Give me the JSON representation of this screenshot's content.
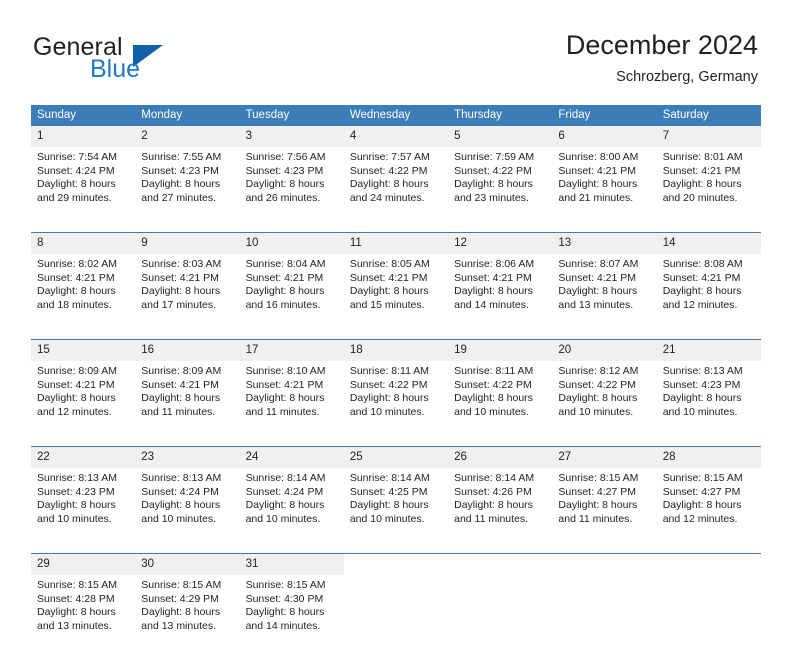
{
  "brand": {
    "name_part1": "General",
    "name_part2": "Blue",
    "triangle_color": "#1260a8",
    "blue_color": "#2079c7"
  },
  "header": {
    "title": "December 2024",
    "location": "Schrozberg, Germany"
  },
  "theme": {
    "header_blue": "#3b7cb9",
    "daynum_bg": "#f0f0f0",
    "text": "#231f20"
  },
  "weekday_headers": [
    "Sunday",
    "Monday",
    "Tuesday",
    "Wednesday",
    "Thursday",
    "Friday",
    "Saturday"
  ],
  "weeks": [
    [
      {
        "day": "1",
        "sunrise": "Sunrise: 7:54 AM",
        "sunset": "Sunset: 4:24 PM",
        "daylight1": "Daylight: 8 hours",
        "daylight2": "and 29 minutes."
      },
      {
        "day": "2",
        "sunrise": "Sunrise: 7:55 AM",
        "sunset": "Sunset: 4:23 PM",
        "daylight1": "Daylight: 8 hours",
        "daylight2": "and 27 minutes."
      },
      {
        "day": "3",
        "sunrise": "Sunrise: 7:56 AM",
        "sunset": "Sunset: 4:23 PM",
        "daylight1": "Daylight: 8 hours",
        "daylight2": "and 26 minutes."
      },
      {
        "day": "4",
        "sunrise": "Sunrise: 7:57 AM",
        "sunset": "Sunset: 4:22 PM",
        "daylight1": "Daylight: 8 hours",
        "daylight2": "and 24 minutes."
      },
      {
        "day": "5",
        "sunrise": "Sunrise: 7:59 AM",
        "sunset": "Sunset: 4:22 PM",
        "daylight1": "Daylight: 8 hours",
        "daylight2": "and 23 minutes."
      },
      {
        "day": "6",
        "sunrise": "Sunrise: 8:00 AM",
        "sunset": "Sunset: 4:21 PM",
        "daylight1": "Daylight: 8 hours",
        "daylight2": "and 21 minutes."
      },
      {
        "day": "7",
        "sunrise": "Sunrise: 8:01 AM",
        "sunset": "Sunset: 4:21 PM",
        "daylight1": "Daylight: 8 hours",
        "daylight2": "and 20 minutes."
      }
    ],
    [
      {
        "day": "8",
        "sunrise": "Sunrise: 8:02 AM",
        "sunset": "Sunset: 4:21 PM",
        "daylight1": "Daylight: 8 hours",
        "daylight2": "and 18 minutes."
      },
      {
        "day": "9",
        "sunrise": "Sunrise: 8:03 AM",
        "sunset": "Sunset: 4:21 PM",
        "daylight1": "Daylight: 8 hours",
        "daylight2": "and 17 minutes."
      },
      {
        "day": "10",
        "sunrise": "Sunrise: 8:04 AM",
        "sunset": "Sunset: 4:21 PM",
        "daylight1": "Daylight: 8 hours",
        "daylight2": "and 16 minutes."
      },
      {
        "day": "11",
        "sunrise": "Sunrise: 8:05 AM",
        "sunset": "Sunset: 4:21 PM",
        "daylight1": "Daylight: 8 hours",
        "daylight2": "and 15 minutes."
      },
      {
        "day": "12",
        "sunrise": "Sunrise: 8:06 AM",
        "sunset": "Sunset: 4:21 PM",
        "daylight1": "Daylight: 8 hours",
        "daylight2": "and 14 minutes."
      },
      {
        "day": "13",
        "sunrise": "Sunrise: 8:07 AM",
        "sunset": "Sunset: 4:21 PM",
        "daylight1": "Daylight: 8 hours",
        "daylight2": "and 13 minutes."
      },
      {
        "day": "14",
        "sunrise": "Sunrise: 8:08 AM",
        "sunset": "Sunset: 4:21 PM",
        "daylight1": "Daylight: 8 hours",
        "daylight2": "and 12 minutes."
      }
    ],
    [
      {
        "day": "15",
        "sunrise": "Sunrise: 8:09 AM",
        "sunset": "Sunset: 4:21 PM",
        "daylight1": "Daylight: 8 hours",
        "daylight2": "and 12 minutes."
      },
      {
        "day": "16",
        "sunrise": "Sunrise: 8:09 AM",
        "sunset": "Sunset: 4:21 PM",
        "daylight1": "Daylight: 8 hours",
        "daylight2": "and 11 minutes."
      },
      {
        "day": "17",
        "sunrise": "Sunrise: 8:10 AM",
        "sunset": "Sunset: 4:21 PM",
        "daylight1": "Daylight: 8 hours",
        "daylight2": "and 11 minutes."
      },
      {
        "day": "18",
        "sunrise": "Sunrise: 8:11 AM",
        "sunset": "Sunset: 4:22 PM",
        "daylight1": "Daylight: 8 hours",
        "daylight2": "and 10 minutes."
      },
      {
        "day": "19",
        "sunrise": "Sunrise: 8:11 AM",
        "sunset": "Sunset: 4:22 PM",
        "daylight1": "Daylight: 8 hours",
        "daylight2": "and 10 minutes."
      },
      {
        "day": "20",
        "sunrise": "Sunrise: 8:12 AM",
        "sunset": "Sunset: 4:22 PM",
        "daylight1": "Daylight: 8 hours",
        "daylight2": "and 10 minutes."
      },
      {
        "day": "21",
        "sunrise": "Sunrise: 8:13 AM",
        "sunset": "Sunset: 4:23 PM",
        "daylight1": "Daylight: 8 hours",
        "daylight2": "and 10 minutes."
      }
    ],
    [
      {
        "day": "22",
        "sunrise": "Sunrise: 8:13 AM",
        "sunset": "Sunset: 4:23 PM",
        "daylight1": "Daylight: 8 hours",
        "daylight2": "and 10 minutes."
      },
      {
        "day": "23",
        "sunrise": "Sunrise: 8:13 AM",
        "sunset": "Sunset: 4:24 PM",
        "daylight1": "Daylight: 8 hours",
        "daylight2": "and 10 minutes."
      },
      {
        "day": "24",
        "sunrise": "Sunrise: 8:14 AM",
        "sunset": "Sunset: 4:24 PM",
        "daylight1": "Daylight: 8 hours",
        "daylight2": "and 10 minutes."
      },
      {
        "day": "25",
        "sunrise": "Sunrise: 8:14 AM",
        "sunset": "Sunset: 4:25 PM",
        "daylight1": "Daylight: 8 hours",
        "daylight2": "and 10 minutes."
      },
      {
        "day": "26",
        "sunrise": "Sunrise: 8:14 AM",
        "sunset": "Sunset: 4:26 PM",
        "daylight1": "Daylight: 8 hours",
        "daylight2": "and 11 minutes."
      },
      {
        "day": "27",
        "sunrise": "Sunrise: 8:15 AM",
        "sunset": "Sunset: 4:27 PM",
        "daylight1": "Daylight: 8 hours",
        "daylight2": "and 11 minutes."
      },
      {
        "day": "28",
        "sunrise": "Sunrise: 8:15 AM",
        "sunset": "Sunset: 4:27 PM",
        "daylight1": "Daylight: 8 hours",
        "daylight2": "and 12 minutes."
      }
    ],
    [
      {
        "day": "29",
        "sunrise": "Sunrise: 8:15 AM",
        "sunset": "Sunset: 4:28 PM",
        "daylight1": "Daylight: 8 hours",
        "daylight2": "and 13 minutes."
      },
      {
        "day": "30",
        "sunrise": "Sunrise: 8:15 AM",
        "sunset": "Sunset: 4:29 PM",
        "daylight1": "Daylight: 8 hours",
        "daylight2": "and 13 minutes."
      },
      {
        "day": "31",
        "sunrise": "Sunrise: 8:15 AM",
        "sunset": "Sunset: 4:30 PM",
        "daylight1": "Daylight: 8 hours",
        "daylight2": "and 14 minutes."
      },
      {
        "day": "",
        "sunrise": "",
        "sunset": "",
        "daylight1": "",
        "daylight2": ""
      },
      {
        "day": "",
        "sunrise": "",
        "sunset": "",
        "daylight1": "",
        "daylight2": ""
      },
      {
        "day": "",
        "sunrise": "",
        "sunset": "",
        "daylight1": "",
        "daylight2": ""
      },
      {
        "day": "",
        "sunrise": "",
        "sunset": "",
        "daylight1": "",
        "daylight2": ""
      }
    ]
  ]
}
